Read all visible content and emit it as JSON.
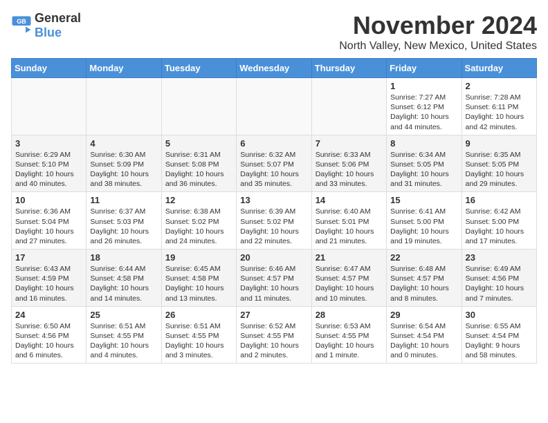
{
  "header": {
    "logo_general": "General",
    "logo_blue": "Blue",
    "month_title": "November 2024",
    "location": "North Valley, New Mexico, United States"
  },
  "weekdays": [
    "Sunday",
    "Monday",
    "Tuesday",
    "Wednesday",
    "Thursday",
    "Friday",
    "Saturday"
  ],
  "weeks": [
    [
      {
        "day": "",
        "info": ""
      },
      {
        "day": "",
        "info": ""
      },
      {
        "day": "",
        "info": ""
      },
      {
        "day": "",
        "info": ""
      },
      {
        "day": "",
        "info": ""
      },
      {
        "day": "1",
        "info": "Sunrise: 7:27 AM\nSunset: 6:12 PM\nDaylight: 10 hours and 44 minutes."
      },
      {
        "day": "2",
        "info": "Sunrise: 7:28 AM\nSunset: 6:11 PM\nDaylight: 10 hours and 42 minutes."
      }
    ],
    [
      {
        "day": "3",
        "info": "Sunrise: 6:29 AM\nSunset: 5:10 PM\nDaylight: 10 hours and 40 minutes."
      },
      {
        "day": "4",
        "info": "Sunrise: 6:30 AM\nSunset: 5:09 PM\nDaylight: 10 hours and 38 minutes."
      },
      {
        "day": "5",
        "info": "Sunrise: 6:31 AM\nSunset: 5:08 PM\nDaylight: 10 hours and 36 minutes."
      },
      {
        "day": "6",
        "info": "Sunrise: 6:32 AM\nSunset: 5:07 PM\nDaylight: 10 hours and 35 minutes."
      },
      {
        "day": "7",
        "info": "Sunrise: 6:33 AM\nSunset: 5:06 PM\nDaylight: 10 hours and 33 minutes."
      },
      {
        "day": "8",
        "info": "Sunrise: 6:34 AM\nSunset: 5:05 PM\nDaylight: 10 hours and 31 minutes."
      },
      {
        "day": "9",
        "info": "Sunrise: 6:35 AM\nSunset: 5:05 PM\nDaylight: 10 hours and 29 minutes."
      }
    ],
    [
      {
        "day": "10",
        "info": "Sunrise: 6:36 AM\nSunset: 5:04 PM\nDaylight: 10 hours and 27 minutes."
      },
      {
        "day": "11",
        "info": "Sunrise: 6:37 AM\nSunset: 5:03 PM\nDaylight: 10 hours and 26 minutes."
      },
      {
        "day": "12",
        "info": "Sunrise: 6:38 AM\nSunset: 5:02 PM\nDaylight: 10 hours and 24 minutes."
      },
      {
        "day": "13",
        "info": "Sunrise: 6:39 AM\nSunset: 5:02 PM\nDaylight: 10 hours and 22 minutes."
      },
      {
        "day": "14",
        "info": "Sunrise: 6:40 AM\nSunset: 5:01 PM\nDaylight: 10 hours and 21 minutes."
      },
      {
        "day": "15",
        "info": "Sunrise: 6:41 AM\nSunset: 5:00 PM\nDaylight: 10 hours and 19 minutes."
      },
      {
        "day": "16",
        "info": "Sunrise: 6:42 AM\nSunset: 5:00 PM\nDaylight: 10 hours and 17 minutes."
      }
    ],
    [
      {
        "day": "17",
        "info": "Sunrise: 6:43 AM\nSunset: 4:59 PM\nDaylight: 10 hours and 16 minutes."
      },
      {
        "day": "18",
        "info": "Sunrise: 6:44 AM\nSunset: 4:58 PM\nDaylight: 10 hours and 14 minutes."
      },
      {
        "day": "19",
        "info": "Sunrise: 6:45 AM\nSunset: 4:58 PM\nDaylight: 10 hours and 13 minutes."
      },
      {
        "day": "20",
        "info": "Sunrise: 6:46 AM\nSunset: 4:57 PM\nDaylight: 10 hours and 11 minutes."
      },
      {
        "day": "21",
        "info": "Sunrise: 6:47 AM\nSunset: 4:57 PM\nDaylight: 10 hours and 10 minutes."
      },
      {
        "day": "22",
        "info": "Sunrise: 6:48 AM\nSunset: 4:57 PM\nDaylight: 10 hours and 8 minutes."
      },
      {
        "day": "23",
        "info": "Sunrise: 6:49 AM\nSunset: 4:56 PM\nDaylight: 10 hours and 7 minutes."
      }
    ],
    [
      {
        "day": "24",
        "info": "Sunrise: 6:50 AM\nSunset: 4:56 PM\nDaylight: 10 hours and 6 minutes."
      },
      {
        "day": "25",
        "info": "Sunrise: 6:51 AM\nSunset: 4:55 PM\nDaylight: 10 hours and 4 minutes."
      },
      {
        "day": "26",
        "info": "Sunrise: 6:51 AM\nSunset: 4:55 PM\nDaylight: 10 hours and 3 minutes."
      },
      {
        "day": "27",
        "info": "Sunrise: 6:52 AM\nSunset: 4:55 PM\nDaylight: 10 hours and 2 minutes."
      },
      {
        "day": "28",
        "info": "Sunrise: 6:53 AM\nSunset: 4:55 PM\nDaylight: 10 hours and 1 minute."
      },
      {
        "day": "29",
        "info": "Sunrise: 6:54 AM\nSunset: 4:54 PM\nDaylight: 10 hours and 0 minutes."
      },
      {
        "day": "30",
        "info": "Sunrise: 6:55 AM\nSunset: 4:54 PM\nDaylight: 9 hours and 58 minutes."
      }
    ]
  ]
}
